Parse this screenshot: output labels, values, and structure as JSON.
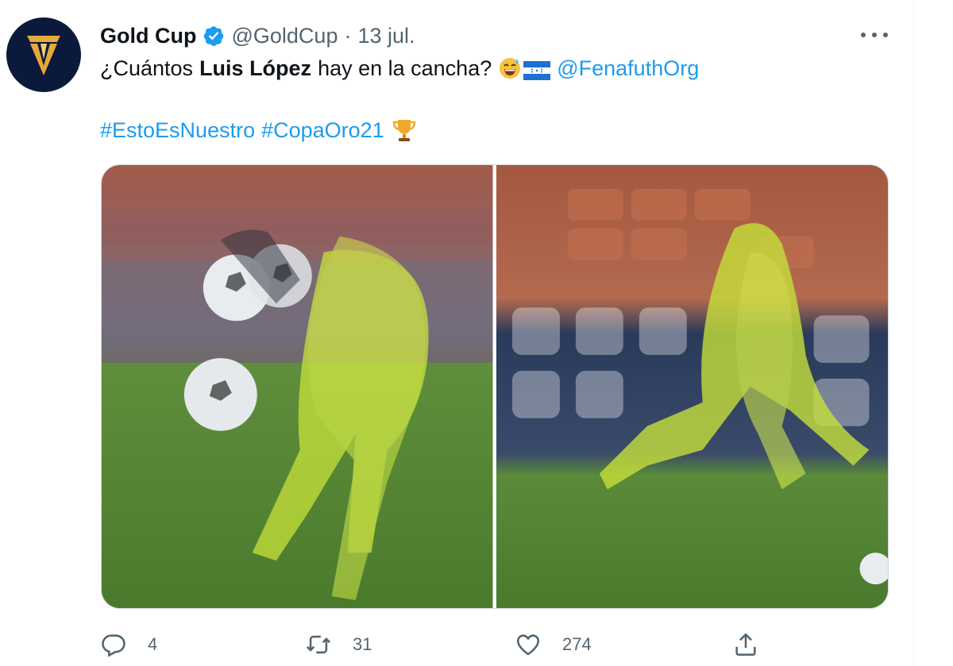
{
  "tweet": {
    "display_name": "Gold Cup",
    "handle": "@GoldCup",
    "separator": "·",
    "date": "13 jul.",
    "text": {
      "question_pre": "¿Cuántos",
      "question_bold": "Luis López",
      "question_post": "hay en la cancha?",
      "mention": "@FenafuthOrg",
      "hashtag1": "#EstoEsNuestro",
      "hashtag2": "#CopaOro21"
    },
    "emoji": [
      "grinning-sweat-emoji",
      "honduras-flag-emoji",
      "trophy-emoji"
    ],
    "stats": {
      "replies": "4",
      "retweets": "31",
      "likes": "274"
    }
  },
  "icons": {
    "verified": "verified-badge-icon",
    "more": "more-options-icon",
    "reply": "reply-icon",
    "retweet": "retweet-icon",
    "like": "heart-icon",
    "share": "share-icon"
  },
  "colors": {
    "link": "#1d9bf0",
    "secondary_text": "#536471",
    "avatar_bg": "#0b1a3a",
    "logo_gold": "#e6a93a",
    "kit_yellow": "#c8e63a",
    "pitch_green": "#5f8a3a"
  }
}
